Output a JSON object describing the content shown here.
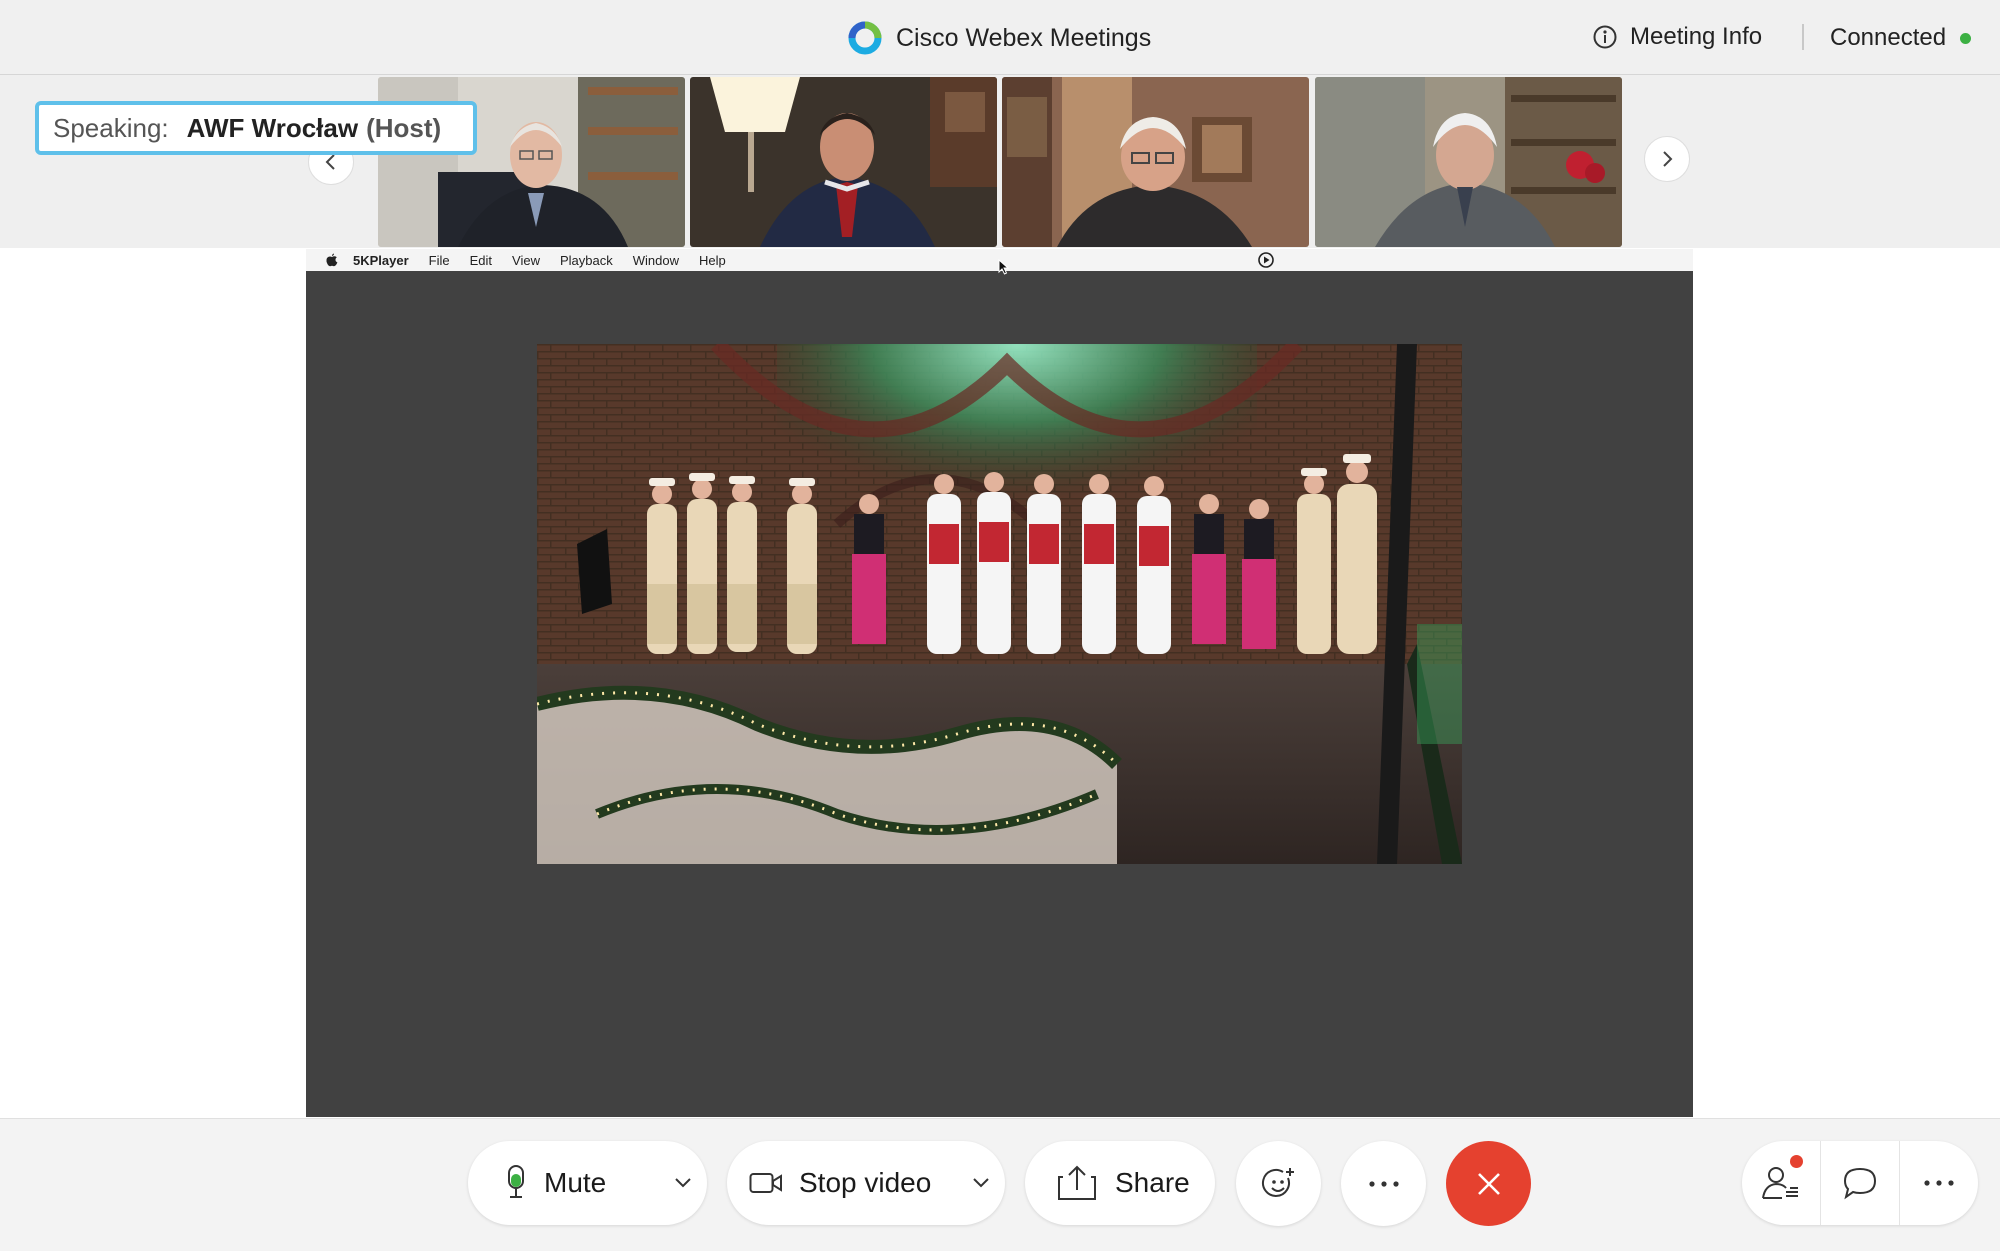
{
  "window": {
    "app_title": "Cisco Webex Meetings",
    "meeting_info_label": "Meeting Info",
    "connection_status": "Connected",
    "status_color": "#3cb043"
  },
  "filmstrip": {
    "speaking_prefix": "Speaking:",
    "speaking_name": "AWF Wrocław",
    "speaking_role": "(Host)",
    "participants": [
      {
        "video": "participant-video-1"
      },
      {
        "video": "participant-video-2"
      },
      {
        "video": "participant-video-3"
      },
      {
        "video": "participant-video-4"
      }
    ]
  },
  "shared_screen": {
    "app_name": "5KPlayer",
    "menus": [
      "File",
      "Edit",
      "View",
      "Playback",
      "Window",
      "Help"
    ]
  },
  "toolbar": {
    "mute_label": "Mute",
    "stop_video_label": "Stop video",
    "share_label": "Share",
    "end_color": "#e5412f"
  },
  "icons": {
    "app_logo": "webex-logo-icon",
    "info": "info-icon",
    "prev": "chevron-left-icon",
    "next": "chevron-right-icon",
    "mic": "microphone-icon",
    "camera": "video-camera-icon",
    "share": "share-upload-icon",
    "reactions": "reactions-icon",
    "more": "more-icon",
    "end": "close-icon",
    "participants": "participants-icon",
    "chat": "chat-icon"
  }
}
